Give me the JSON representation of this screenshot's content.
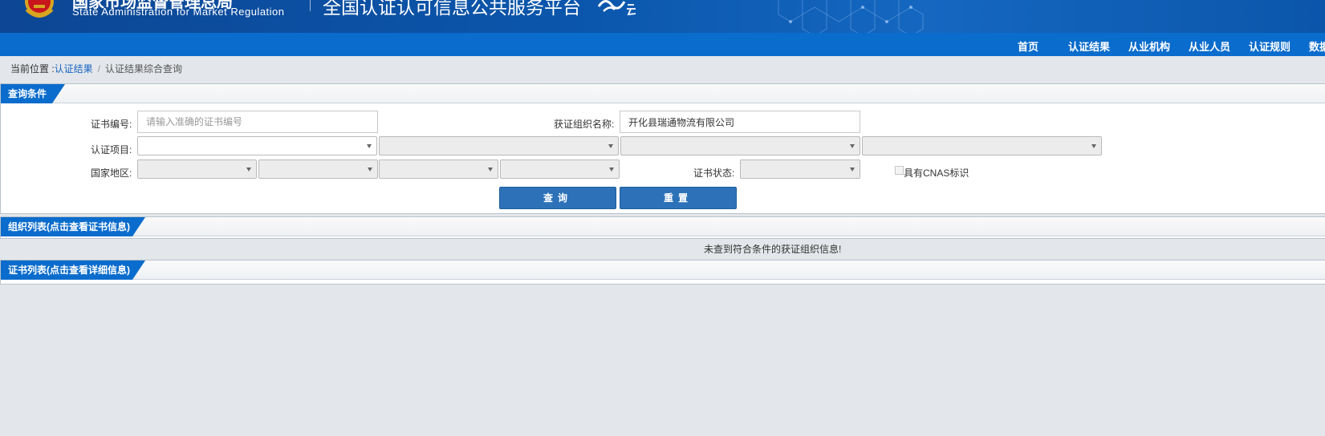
{
  "header": {
    "agency_cn": "国家市场监督管理总局",
    "agency_en": "State Administration  for  Market Regulation",
    "platform": "全国认证认可信息公共服务平台"
  },
  "nav": {
    "items": [
      "首页",
      "认证结果",
      "从业机构",
      "从业人员",
      "认证规则",
      "数据"
    ]
  },
  "breadcrumb": {
    "prefix": "当前位置 :",
    "link": "认证结果",
    "separator": "/",
    "current": "认证结果综合查询"
  },
  "query": {
    "title": "查询条件",
    "cert_no_label": "证书编号:",
    "cert_no_placeholder": "请输入准确的证书编号",
    "cert_no_value": "",
    "org_name_label": "获证组织名称:",
    "org_name_value": "开化县瑞通物流有限公司",
    "project_label": "认证项目:",
    "region_label": "国家地区:",
    "status_label": "证书状态:",
    "cnas_label": "具有CNAS标识",
    "search_button": "查询",
    "reset_button": "重置"
  },
  "org_list": {
    "title": "组织列表(点击查看证书信息)",
    "empty_message": "未查到符合条件的获证组织信息!"
  },
  "cert_list": {
    "title": "证书列表(点击查看详细信息)"
  },
  "colors": {
    "nav_bg": "#0a6ccc",
    "header_bg": "#0b57ad",
    "button_bg": "#2d72b8",
    "link": "#1a66c2"
  }
}
